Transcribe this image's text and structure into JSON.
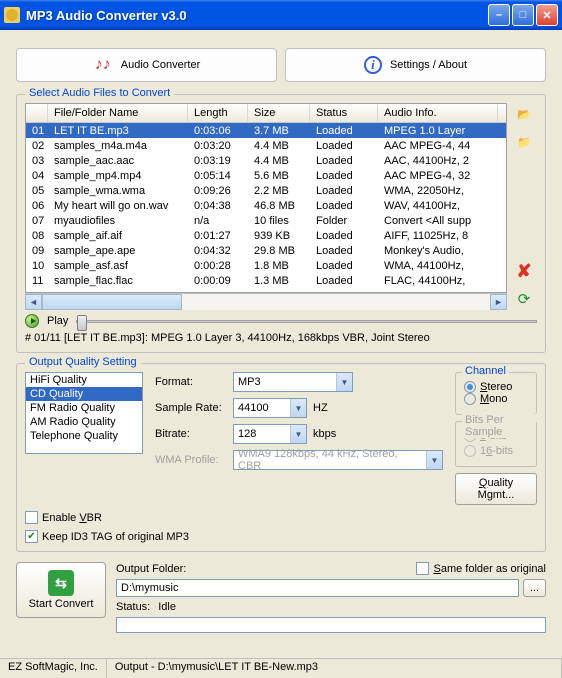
{
  "window": {
    "title": "MP3 Audio Converter v3.0"
  },
  "tabs": {
    "converter": "Audio Converter",
    "settings": "Settings / About"
  },
  "files": {
    "legend": "Select Audio Files to Convert",
    "headers": {
      "name": "File/Folder Name",
      "length": "Length",
      "size": "Size",
      "status": "Status",
      "info": "Audio Info."
    },
    "rows": [
      {
        "n": "01",
        "name": "LET IT BE.mp3",
        "length": "0:03:06",
        "size": "3.7 MB",
        "status": "Loaded",
        "info": "MPEG 1.0 Layer"
      },
      {
        "n": "02",
        "name": "samples_m4a.m4a",
        "length": "0:03:20",
        "size": "4.4 MB",
        "status": "Loaded",
        "info": "AAC MPEG-4, 44"
      },
      {
        "n": "03",
        "name": "sample_aac.aac",
        "length": "0:03:19",
        "size": "4.4 MB",
        "status": "Loaded",
        "info": "AAC, 44100Hz, 2"
      },
      {
        "n": "04",
        "name": "sample_mp4.mp4",
        "length": "0:05:14",
        "size": "5.6 MB",
        "status": "Loaded",
        "info": "AAC MPEG-4, 32"
      },
      {
        "n": "05",
        "name": "sample_wma.wma",
        "length": "0:09:26",
        "size": "2.2 MB",
        "status": "Loaded",
        "info": "WMA, 22050Hz,"
      },
      {
        "n": "06",
        "name": "My heart will go on.wav",
        "length": "0:04:38",
        "size": "46.8 MB",
        "status": "Loaded",
        "info": "WAV, 44100Hz,"
      },
      {
        "n": "07",
        "name": "myaudiofiles",
        "length": "n/a",
        "size": "10 files",
        "status": "Folder",
        "info": "Convert <All supp"
      },
      {
        "n": "08",
        "name": "sample_aif.aif",
        "length": "0:01:27",
        "size": "939 KB",
        "status": "Loaded",
        "info": "AIFF, 11025Hz, 8"
      },
      {
        "n": "09",
        "name": "sample_ape.ape",
        "length": "0:04:32",
        "size": "29.8 MB",
        "status": "Loaded",
        "info": "Monkey's Audio,"
      },
      {
        "n": "10",
        "name": "sample_asf.asf",
        "length": "0:00:28",
        "size": "1.8 MB",
        "status": "Loaded",
        "info": "WMA, 44100Hz,"
      },
      {
        "n": "11",
        "name": "sample_flac.flac",
        "length": "0:00:09",
        "size": "1.3 MB",
        "status": "Loaded",
        "info": "FLAC, 44100Hz,"
      }
    ]
  },
  "play": {
    "label": "Play",
    "info": "# 01/11 [LET IT BE.mp3]: MPEG 1.0 Layer 3, 44100Hz, 168kbps VBR, Joint Stereo"
  },
  "quality": {
    "legend": "Output Quality Setting",
    "presets": [
      "HiFi Quality",
      "CD Quality",
      "FM Radio Quality",
      "AM Radio Quality",
      "Telephone Quality"
    ],
    "format_label": "Format:",
    "format": "MP3",
    "rate_label": "Sample Rate:",
    "rate": "44100",
    "rate_unit": "HZ",
    "bitrate_label": "Bitrate:",
    "bitrate": "128",
    "bitrate_unit": "kbps",
    "wma_label": "WMA Profile:",
    "wma": "WMA9 128kbps, 44 kHz, Stereo, CBR",
    "channel_legend": "Channel",
    "stereo": "Stereo",
    "mono": "Mono",
    "bits_legend": "Bits Per Sample",
    "bits8": "8-bits",
    "bits16": "16-bits",
    "vbr": "Enable VBR",
    "id3": "Keep ID3 TAG of original MP3",
    "mgmt": "Quality Mgmt..."
  },
  "output": {
    "folder_label": "Output Folder:",
    "folder": "D:\\mymusic",
    "same": "Same folder as original",
    "status_label": "Status:",
    "status": "Idle",
    "start": "Start Convert"
  },
  "status": {
    "company": "EZ SoftMagic, Inc.",
    "out": "Output - D:\\mymusic\\LET IT BE-New.mp3"
  }
}
